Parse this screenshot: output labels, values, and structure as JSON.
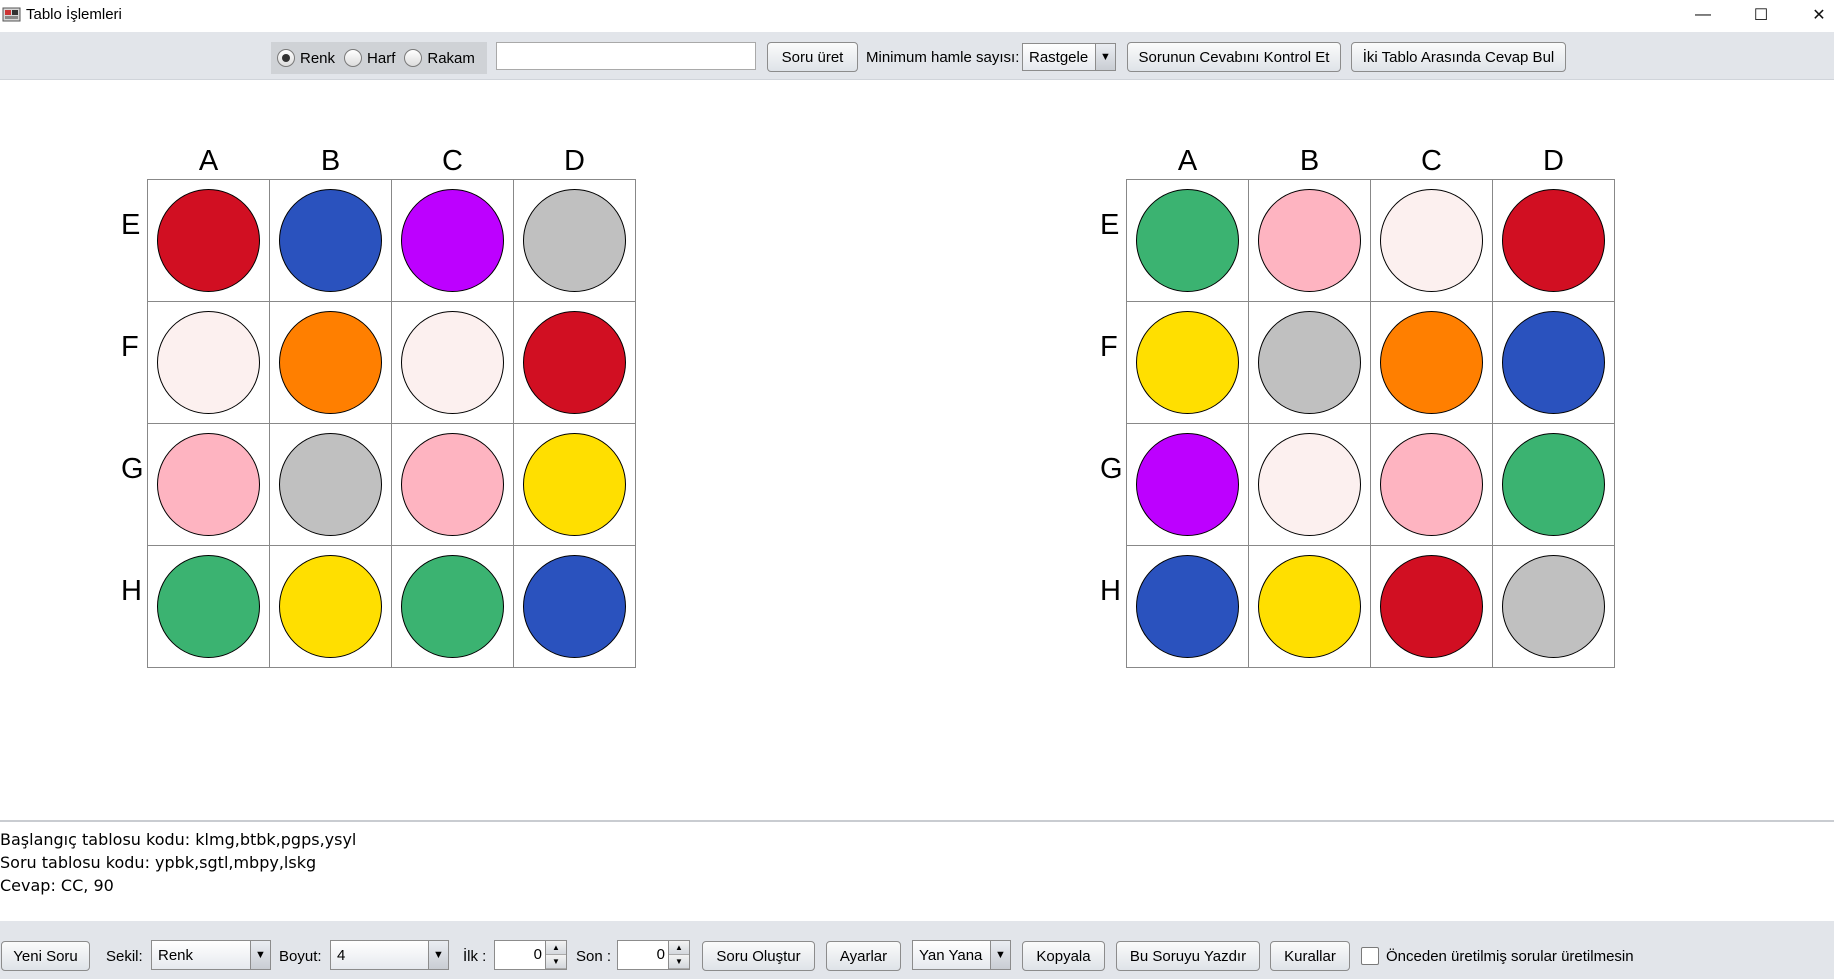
{
  "window": {
    "title": "Tablo İşlemleri",
    "minimize": "—",
    "maximize": "☐",
    "close": "✕"
  },
  "toolbar": {
    "radios": [
      {
        "label": "Renk",
        "checked": true
      },
      {
        "label": "Harf",
        "checked": false
      },
      {
        "label": "Rakam",
        "checked": false
      }
    ],
    "input_value": "",
    "generate_label": "Soru üret",
    "min_moves_label": "Minimum hamle sayısı:",
    "min_moves_value": "Rastgele",
    "check_answer_label": "Sorunun Cevabını Kontrol Et",
    "find_answer_label": "İki Tablo Arasında Cevap Bul"
  },
  "colors": {
    "k": "#d10f22",
    "l": "#2a52be",
    "m": "#bd00ff",
    "g": "#c0c0c0",
    "b": "#fcf0ef",
    "t": "#ff7f00",
    "p": "#feb4c1",
    "s": "#ffdf00",
    "y": "#3bb371"
  },
  "boards": {
    "columns": [
      "A",
      "B",
      "C",
      "D"
    ],
    "rows": [
      "E",
      "F",
      "G",
      "H"
    ],
    "left": [
      [
        "k",
        "l",
        "m",
        "g"
      ],
      [
        "b",
        "t",
        "b",
        "k"
      ],
      [
        "p",
        "g",
        "p",
        "s"
      ],
      [
        "y",
        "s",
        "y",
        "l"
      ]
    ],
    "right": [
      [
        "y",
        "p",
        "b",
        "k"
      ],
      [
        "s",
        "g",
        "t",
        "l"
      ],
      [
        "m",
        "b",
        "p",
        "y"
      ],
      [
        "l",
        "s",
        "k",
        "g"
      ]
    ]
  },
  "output": {
    "line1": "Başlangıç tablosu kodu: klmg,btbk,pgps,ysyl",
    "line2": "Soru tablosu kodu: ypbk,sgtl,mbpy,lskg",
    "line3": "Cevap: CC, 90"
  },
  "bottom": {
    "new_question": "Yeni Soru",
    "shape_label": "Sekil:",
    "shape_value": "Renk",
    "size_label": "Boyut:",
    "size_value": "4",
    "first_label": "İlk :",
    "first_value": "0",
    "last_label": "Son :",
    "last_value": "0",
    "create": "Soru Oluştur",
    "settings": "Ayarlar",
    "layout_value": "Yan Yana",
    "copy": "Kopyala",
    "print": "Bu Soruyu Yazdır",
    "rules": "Kurallar",
    "no_repeat_label": "Önceden üretilmiş sorular üretilmesin",
    "no_repeat_checked": false
  }
}
